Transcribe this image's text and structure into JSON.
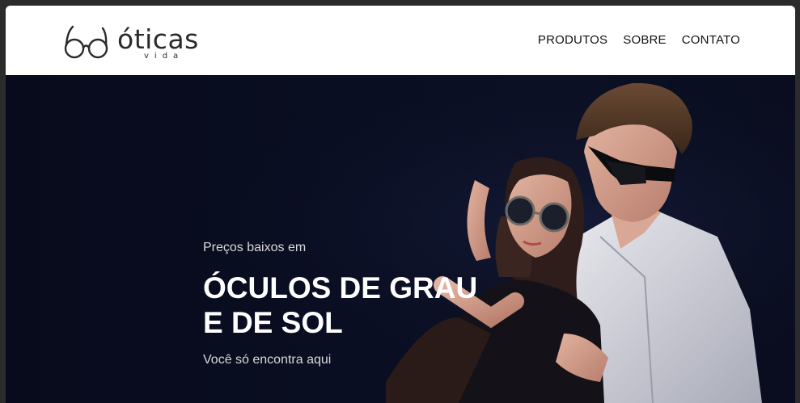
{
  "brand": {
    "name": "óticas",
    "sub": "vida"
  },
  "nav": {
    "items": [
      {
        "label": "PRODUTOS"
      },
      {
        "label": "SOBRE"
      },
      {
        "label": "CONTATO"
      }
    ]
  },
  "hero": {
    "kicker": "Preços baixos em",
    "headline": "ÓCULOS DE GRAU E DE SOL",
    "tagline": "Você só encontra aqui"
  },
  "colors": {
    "hero_background": "#0a0e22",
    "headline": "#ffffff",
    "logo": "#2a2a2a"
  }
}
